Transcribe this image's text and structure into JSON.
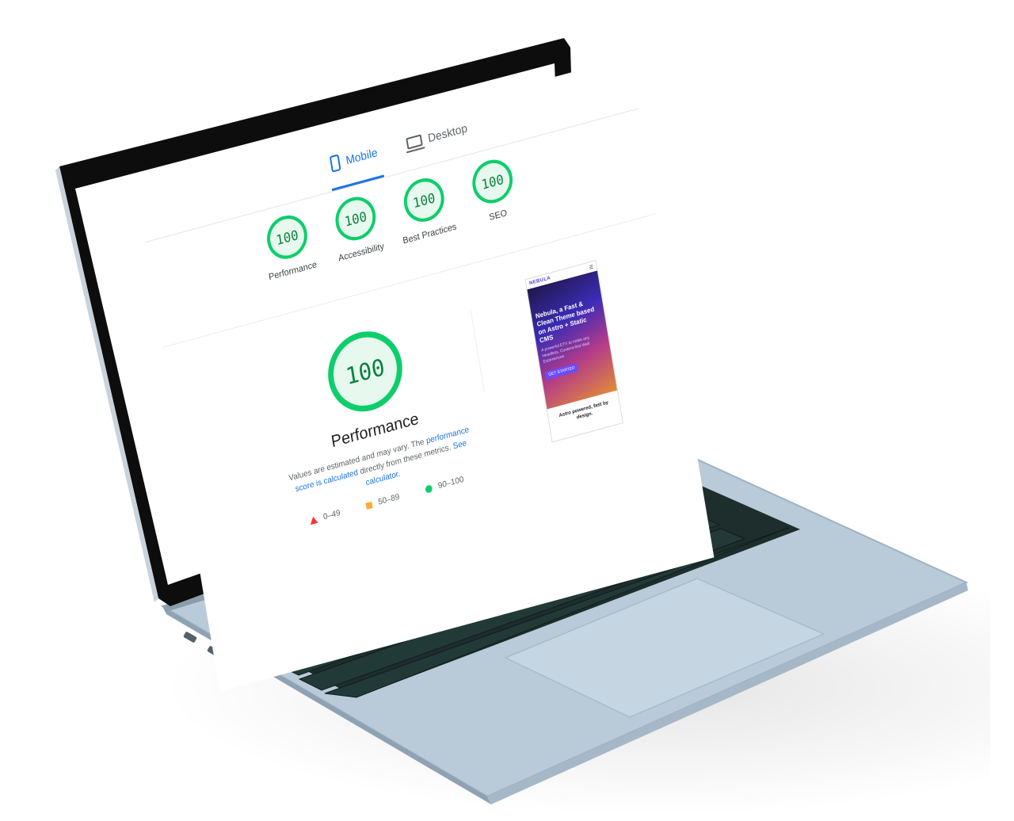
{
  "tabs": [
    {
      "label": "Mobile",
      "icon": "mobile-icon",
      "active": true
    },
    {
      "label": "Desktop",
      "icon": "desktop-icon",
      "active": false
    }
  ],
  "scores": [
    {
      "value": "100",
      "label": "Performance"
    },
    {
      "value": "100",
      "label": "Accessibility"
    },
    {
      "value": "100",
      "label": "Best Practices"
    },
    {
      "value": "100",
      "label": "SEO"
    }
  ],
  "main": {
    "value": "100",
    "title": "Performance",
    "desc_prefix": "Values are estimated and may vary. The ",
    "desc_link": "performance score is calculated",
    "desc_mid": " directly from these metrics. ",
    "desc_link2": "See calculator."
  },
  "legend": [
    {
      "shape": "triangle",
      "range": "0–49",
      "color": "#ff3333"
    },
    {
      "shape": "square",
      "range": "50–89",
      "color": "#ffaa33"
    },
    {
      "shape": "circle",
      "range": "90–100",
      "color": "#0cce6b"
    }
  ],
  "screenshot": {
    "logo": "NEBULA",
    "heading": "Nebula, a Fast & Clean Theme based on Astro + Static CMS",
    "subtext": "A powerful ETV to make any Headless, Content-first Web Experiences",
    "button": "GET STARTED",
    "footer": "Astro powered, fast by design."
  },
  "device_label": "MacBook Air",
  "colors": {
    "good": "#0cce6b",
    "accent": "#1a73e8",
    "keyboard": "#1d2e2c",
    "body": "#b9c9d6"
  }
}
